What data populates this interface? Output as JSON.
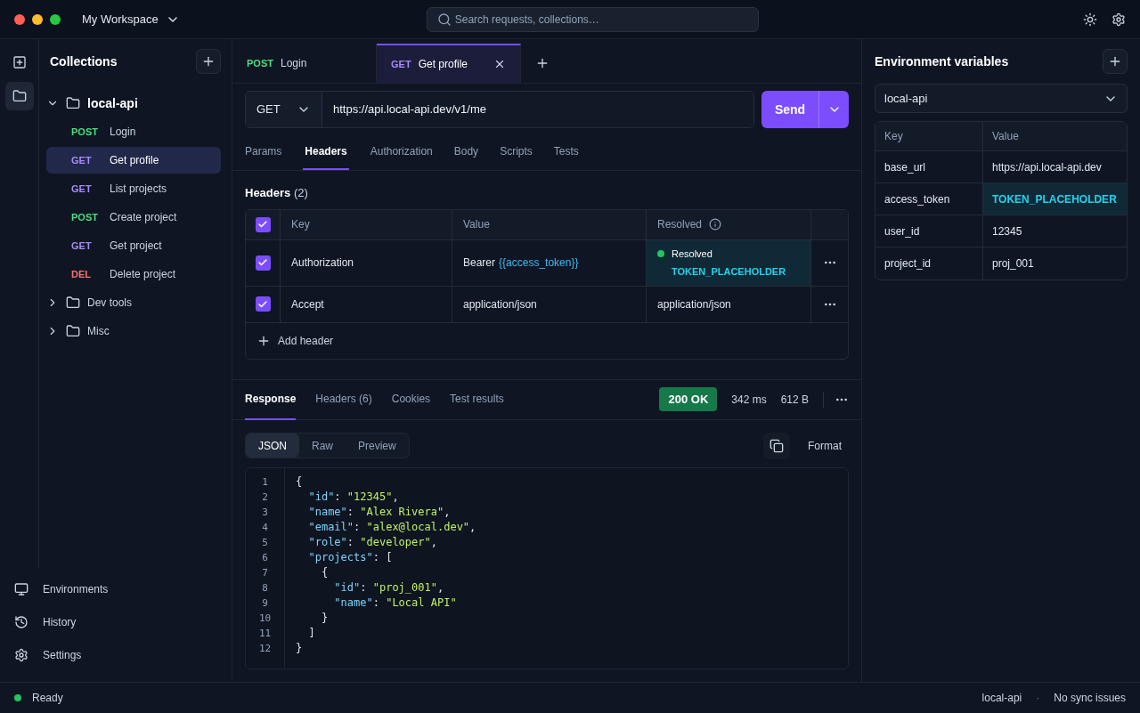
{
  "window": {
    "workspace": "My Workspace",
    "search_placeholder": "Search requests, collections…"
  },
  "rail": [
    {
      "kind": "new",
      "selected": false
    },
    {
      "kind": "collections",
      "selected": true
    }
  ],
  "sidebar": {
    "title": "Collections",
    "tree": [
      {
        "name": "local-api",
        "expanded": true,
        "children": [
          {
            "method": "POST",
            "color": "#4ade80",
            "name": "Login",
            "selected": false
          },
          {
            "method": "GET",
            "color": "#a78bfa",
            "name": "Get profile",
            "selected": true
          },
          {
            "method": "GET",
            "color": "#a78bfa",
            "name": "List projects",
            "selected": false
          },
          {
            "method": "POST",
            "color": "#4ade80",
            "name": "Create project",
            "selected": false
          },
          {
            "method": "GET",
            "color": "#a78bfa",
            "name": "Get project",
            "selected": false
          },
          {
            "method": "DEL",
            "color": "#f87171",
            "name": "Delete project",
            "selected": false
          }
        ]
      },
      {
        "name": "Dev tools",
        "expanded": false
      },
      {
        "name": "Misc",
        "expanded": false
      }
    ],
    "nav": [
      {
        "kind": "environments",
        "label": "Environments"
      },
      {
        "kind": "history",
        "label": "History"
      },
      {
        "kind": "settings",
        "label": "Settings"
      }
    ]
  },
  "request_tabs": [
    {
      "method": "POST",
      "color": "#4ade80",
      "name": "Login",
      "selected": false
    },
    {
      "method": "GET",
      "color": "#a78bfa",
      "name": "Get profile",
      "selected": true
    }
  ],
  "request": {
    "method": "GET",
    "url": "https://api.local-api.dev/v1/me",
    "send": "Send"
  },
  "section_tabs": [
    {
      "label": "Params",
      "selected": false
    },
    {
      "label": "Headers",
      "selected": true
    },
    {
      "label": "Authorization",
      "selected": false
    },
    {
      "label": "Body",
      "selected": false
    },
    {
      "label": "Scripts",
      "selected": false
    },
    {
      "label": "Tests",
      "selected": false
    }
  ],
  "headers": {
    "title": "Headers",
    "count": "(2)",
    "all_checked": true,
    "columns": [
      "Key",
      "Value",
      "Resolved"
    ],
    "rows": [
      {
        "kind": "variable",
        "checked": true,
        "key": "Authorization",
        "value": "Bearer",
        "variable": "{{access_token}}",
        "resolved_status": "Resolved",
        "resolved": "TOKEN_PLACEHOLDER"
      },
      {
        "kind": "plain",
        "checked": true,
        "key": "Accept",
        "value": "application/json",
        "resolved": "application/json"
      }
    ],
    "add": "Add header"
  },
  "response": {
    "tabs": [
      {
        "label": "Response",
        "selected": true
      },
      {
        "label": "Headers (6)",
        "selected": false
      },
      {
        "label": "Cookies",
        "selected": false
      },
      {
        "label": "Test results",
        "selected": false
      }
    ],
    "status": "200 OK",
    "time": "342 ms",
    "size": "612 B",
    "views": [
      {
        "label": "JSON",
        "selected": true
      },
      {
        "label": "Raw",
        "selected": false
      },
      {
        "label": "Preview",
        "selected": false
      }
    ],
    "format": "Format",
    "code": [
      {
        "n": "1",
        "text": "{"
      },
      {
        "n": "2",
        "text": "  \"id\": \"12345\","
      },
      {
        "n": "3",
        "text": "  \"name\": \"Alex Rivera\","
      },
      {
        "n": "4",
        "text": "  \"email\": \"alex@local.dev\","
      },
      {
        "n": "5",
        "text": "  \"role\": \"developer\","
      },
      {
        "n": "6",
        "text": "  \"projects\": ["
      },
      {
        "n": "7",
        "text": "    {"
      },
      {
        "n": "8",
        "text": "      \"id\": \"proj_001\","
      },
      {
        "n": "9",
        "text": "      \"name\": \"Local API\""
      },
      {
        "n": "10",
        "text": "    }"
      },
      {
        "n": "11",
        "text": "  ]"
      },
      {
        "n": "12",
        "text": "}"
      }
    ]
  },
  "environment": {
    "title": "Environment variables",
    "selected_env": "local-api",
    "columns": [
      "Key",
      "Value"
    ],
    "rows": [
      {
        "key": "base_url",
        "value": "https://api.local-api.dev",
        "highlighted": false
      },
      {
        "key": "access_token",
        "value": "TOKEN_PLACEHOLDER",
        "highlighted": true
      },
      {
        "key": "user_id",
        "value": "12345",
        "highlighted": false
      },
      {
        "key": "project_id",
        "value": "proj_001",
        "highlighted": false
      }
    ]
  },
  "status_bar": {
    "status": "Ready",
    "environment": "local-api",
    "separator": "·",
    "sync": "No sync issues"
  }
}
